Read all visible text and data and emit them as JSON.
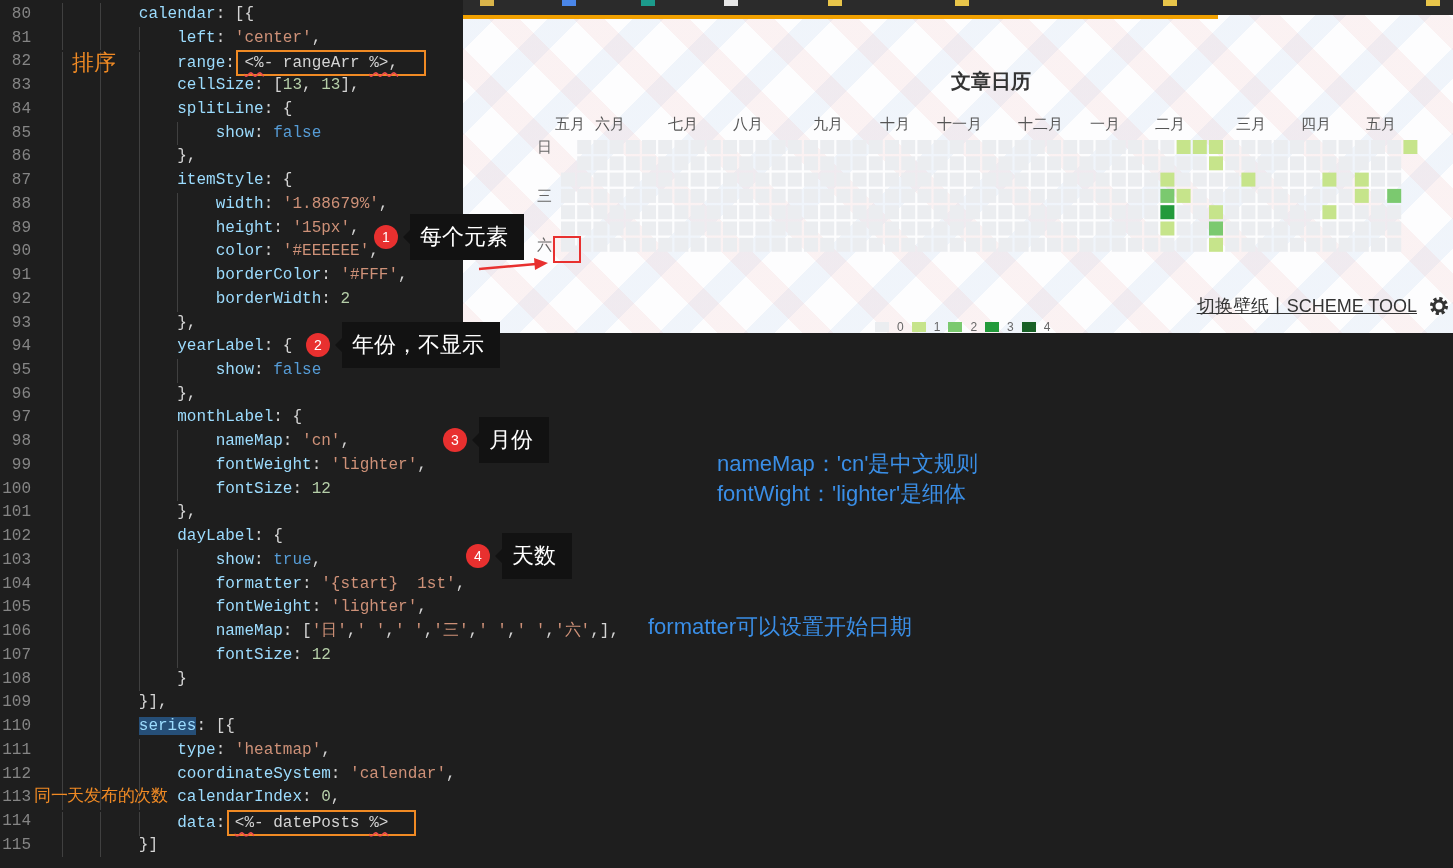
{
  "editor": {
    "lines": [
      {
        "number": "80",
        "tokens": [
          {
            "kind": "key",
            "text": "        calendar"
          },
          {
            "kind": "punct",
            "text": ": [{"
          }
        ]
      },
      {
        "number": "81",
        "tokens": [
          {
            "kind": "key",
            "text": "            left"
          },
          {
            "kind": "punct",
            "text": ": "
          },
          {
            "kind": "string",
            "text": "'center'"
          },
          {
            "kind": "punct",
            "text": ","
          }
        ]
      },
      {
        "number": "82",
        "tokens": [
          {
            "kind": "key",
            "text": "            range"
          },
          {
            "kind": "punct",
            "text": ": "
          }
        ],
        "boxed_tokens": [
          {
            "kind": "error",
            "text": "<%"
          },
          {
            "kind": "plain",
            "text": "- rangeArr "
          },
          {
            "kind": "error",
            "text": "%>,"
          }
        ]
      },
      {
        "number": "83",
        "tokens": [
          {
            "kind": "key",
            "text": "            cellSize"
          },
          {
            "kind": "punct",
            "text": ": ["
          },
          {
            "kind": "number",
            "text": "13"
          },
          {
            "kind": "punct",
            "text": ", "
          },
          {
            "kind": "number",
            "text": "13"
          },
          {
            "kind": "punct",
            "text": "],"
          }
        ]
      },
      {
        "number": "84",
        "tokens": [
          {
            "kind": "key",
            "text": "            splitLine"
          },
          {
            "kind": "punct",
            "text": ": {"
          }
        ]
      },
      {
        "number": "85",
        "tokens": [
          {
            "kind": "key",
            "text": "                show"
          },
          {
            "kind": "punct",
            "text": ": "
          },
          {
            "kind": "keyword",
            "text": "false"
          }
        ]
      },
      {
        "number": "86",
        "tokens": [
          {
            "kind": "punct",
            "text": "            },"
          }
        ]
      },
      {
        "number": "87",
        "tokens": [
          {
            "kind": "key",
            "text": "            itemStyle"
          },
          {
            "kind": "punct",
            "text": ": {"
          }
        ]
      },
      {
        "number": "88",
        "tokens": [
          {
            "kind": "key",
            "text": "                width"
          },
          {
            "kind": "punct",
            "text": ": "
          },
          {
            "kind": "string",
            "text": "'1.88679%'"
          },
          {
            "kind": "punct",
            "text": ","
          }
        ]
      },
      {
        "number": "89",
        "tokens": [
          {
            "kind": "key",
            "text": "                height"
          },
          {
            "kind": "punct",
            "text": ": "
          },
          {
            "kind": "string",
            "text": "'15px'"
          },
          {
            "kind": "punct",
            "text": ","
          }
        ]
      },
      {
        "number": "90",
        "tokens": [
          {
            "kind": "key",
            "text": "                color"
          },
          {
            "kind": "punct",
            "text": ": "
          },
          {
            "kind": "string",
            "text": "'#EEEEEE'"
          },
          {
            "kind": "punct",
            "text": ","
          }
        ]
      },
      {
        "number": "91",
        "tokens": [
          {
            "kind": "key",
            "text": "                borderColor"
          },
          {
            "kind": "punct",
            "text": ": "
          },
          {
            "kind": "string",
            "text": "'#FFF'"
          },
          {
            "kind": "punct",
            "text": ","
          }
        ]
      },
      {
        "number": "92",
        "tokens": [
          {
            "kind": "key",
            "text": "                borderWidth"
          },
          {
            "kind": "punct",
            "text": ": "
          },
          {
            "kind": "number",
            "text": "2"
          }
        ]
      },
      {
        "number": "93",
        "tokens": [
          {
            "kind": "punct",
            "text": "            },"
          }
        ]
      },
      {
        "number": "94",
        "tokens": [
          {
            "kind": "key",
            "text": "            yearLabel"
          },
          {
            "kind": "punct",
            "text": ": {"
          }
        ]
      },
      {
        "number": "95",
        "tokens": [
          {
            "kind": "key",
            "text": "                show"
          },
          {
            "kind": "punct",
            "text": ": "
          },
          {
            "kind": "keyword",
            "text": "false"
          }
        ]
      },
      {
        "number": "96",
        "tokens": [
          {
            "kind": "punct",
            "text": "            },"
          }
        ]
      },
      {
        "number": "97",
        "tokens": [
          {
            "kind": "key",
            "text": "            monthLabel"
          },
          {
            "kind": "punct",
            "text": ": {"
          }
        ]
      },
      {
        "number": "98",
        "tokens": [
          {
            "kind": "key",
            "text": "                nameMap"
          },
          {
            "kind": "punct",
            "text": ": "
          },
          {
            "kind": "string",
            "text": "'cn'"
          },
          {
            "kind": "punct",
            "text": ","
          }
        ]
      },
      {
        "number": "99",
        "tokens": [
          {
            "kind": "key",
            "text": "                fontWeight"
          },
          {
            "kind": "punct",
            "text": ": "
          },
          {
            "kind": "string",
            "text": "'lighter'"
          },
          {
            "kind": "punct",
            "text": ","
          }
        ]
      },
      {
        "number": "100",
        "tokens": [
          {
            "kind": "key",
            "text": "                fontSize"
          },
          {
            "kind": "punct",
            "text": ": "
          },
          {
            "kind": "number",
            "text": "12"
          }
        ]
      },
      {
        "number": "101",
        "tokens": [
          {
            "kind": "punct",
            "text": "            },"
          }
        ]
      },
      {
        "number": "102",
        "tokens": [
          {
            "kind": "key",
            "text": "            dayLabel"
          },
          {
            "kind": "punct",
            "text": ": {"
          }
        ]
      },
      {
        "number": "103",
        "tokens": [
          {
            "kind": "key",
            "text": "                show"
          },
          {
            "kind": "punct",
            "text": ": "
          },
          {
            "kind": "keyword",
            "text": "true"
          },
          {
            "kind": "punct",
            "text": ","
          }
        ]
      },
      {
        "number": "104",
        "tokens": [
          {
            "kind": "key",
            "text": "                formatter"
          },
          {
            "kind": "punct",
            "text": ": "
          },
          {
            "kind": "string",
            "text": "'{start}  1st'"
          },
          {
            "kind": "punct",
            "text": ","
          }
        ]
      },
      {
        "number": "105",
        "tokens": [
          {
            "kind": "key",
            "text": "                fontWeight"
          },
          {
            "kind": "punct",
            "text": ": "
          },
          {
            "kind": "string",
            "text": "'lighter'"
          },
          {
            "kind": "punct",
            "text": ","
          }
        ]
      },
      {
        "number": "106",
        "tokens": [
          {
            "kind": "key",
            "text": "                nameMap"
          },
          {
            "kind": "punct",
            "text": ": ["
          },
          {
            "kind": "string",
            "text": "'日'"
          },
          {
            "kind": "punct",
            "text": ","
          },
          {
            "kind": "string",
            "text": "' '"
          },
          {
            "kind": "punct",
            "text": ","
          },
          {
            "kind": "string",
            "text": "' '"
          },
          {
            "kind": "punct",
            "text": ","
          },
          {
            "kind": "string",
            "text": "'三'"
          },
          {
            "kind": "punct",
            "text": ","
          },
          {
            "kind": "string",
            "text": "' '"
          },
          {
            "kind": "punct",
            "text": ","
          },
          {
            "kind": "string",
            "text": "' '"
          },
          {
            "kind": "punct",
            "text": ","
          },
          {
            "kind": "string",
            "text": "'六'"
          },
          {
            "kind": "punct",
            "text": ",],"
          }
        ]
      },
      {
        "number": "107",
        "tokens": [
          {
            "kind": "key",
            "text": "                fontSize"
          },
          {
            "kind": "punct",
            "text": ": "
          },
          {
            "kind": "number",
            "text": "12"
          }
        ]
      },
      {
        "number": "108",
        "tokens": [
          {
            "kind": "punct",
            "text": "            }"
          }
        ]
      },
      {
        "number": "109",
        "tokens": [
          {
            "kind": "punct",
            "text": "        }],"
          }
        ]
      },
      {
        "number": "110",
        "tokens": [
          {
            "kind": "highlight",
            "text": "        series"
          },
          {
            "kind": "punct",
            "text": ": [{"
          }
        ]
      },
      {
        "number": "111",
        "tokens": [
          {
            "kind": "key",
            "text": "            type"
          },
          {
            "kind": "punct",
            "text": ": "
          },
          {
            "kind": "string",
            "text": "'heatmap'"
          },
          {
            "kind": "punct",
            "text": ","
          }
        ]
      },
      {
        "number": "112",
        "tokens": [
          {
            "kind": "key",
            "text": "            coordinateSystem"
          },
          {
            "kind": "punct",
            "text": ": "
          },
          {
            "kind": "string",
            "text": "'calendar'"
          },
          {
            "kind": "punct",
            "text": ","
          }
        ]
      },
      {
        "number": "113",
        "tokens": [
          {
            "kind": "key",
            "text": "            calendarIndex"
          },
          {
            "kind": "punct",
            "text": ": "
          },
          {
            "kind": "number",
            "text": "0"
          },
          {
            "kind": "punct",
            "text": ","
          }
        ]
      },
      {
        "number": "114",
        "tokens": [
          {
            "kind": "key",
            "text": "            data"
          },
          {
            "kind": "punct",
            "text": ": "
          }
        ],
        "boxed_tokens": [
          {
            "kind": "error",
            "text": "<%"
          },
          {
            "kind": "plain",
            "text": "- datePosts "
          },
          {
            "kind": "error",
            "text": "%>"
          }
        ]
      },
      {
        "number": "115",
        "tokens": [
          {
            "kind": "punct",
            "text": "        }]"
          }
        ]
      }
    ]
  },
  "preview": {
    "title": "文章日历",
    "months": [
      "五月",
      "六月",
      "七月",
      "八月",
      "九月",
      "十月",
      "十一月",
      "十二月",
      "一月",
      "二月",
      "三月",
      "四月",
      "五月"
    ],
    "day_labels": [
      "日",
      "三",
      "六"
    ],
    "footer_link": "切换壁纸丨SCHEME TOOL",
    "legend": [
      {
        "label": "0",
        "color": "#ebedf0"
      },
      {
        "label": "1",
        "color": "#c6e48b"
      },
      {
        "label": "2",
        "color": "#7bc96f"
      },
      {
        "label": "3",
        "color": "#239a3b"
      },
      {
        "label": "4",
        "color": "#196127"
      }
    ]
  },
  "annotations": {
    "labels": [
      "排序",
      "同一天发布的次数"
    ],
    "callouts": [
      {
        "number": "1",
        "text": "每个元素"
      },
      {
        "number": "2",
        "text": "年份，不显示"
      },
      {
        "number": "3",
        "text": "月份"
      },
      {
        "number": "4",
        "text": "天数"
      }
    ],
    "notes": [
      "nameMap：'cn'是中文规则",
      "fontWight：'lighter'是细体",
      "formatter可以设置开始日期"
    ]
  }
}
